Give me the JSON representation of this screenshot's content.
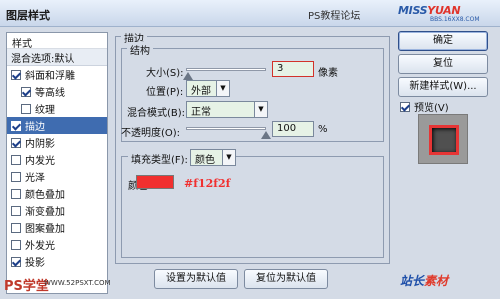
{
  "window": {
    "title": "图层样式"
  },
  "watermark": {
    "text": "PS教程论坛",
    "logo_main": "MISS",
    "logo_accent": "YUAN",
    "logo_url": "BBS.16XX8.COM"
  },
  "sidebar": {
    "header": "样式",
    "blend_options": "混合选项:默认",
    "items": [
      {
        "label": "斜面和浮雕",
        "checked": true
      },
      {
        "label": "等高线",
        "checked": true,
        "indent": true
      },
      {
        "label": "纹理",
        "checked": false,
        "indent": true
      },
      {
        "label": "描边",
        "checked": true,
        "selected": true
      },
      {
        "label": "内阴影",
        "checked": true
      },
      {
        "label": "内发光",
        "checked": false
      },
      {
        "label": "光泽",
        "checked": false
      },
      {
        "label": "颜色叠加",
        "checked": false
      },
      {
        "label": "渐变叠加",
        "checked": false
      },
      {
        "label": "图案叠加",
        "checked": false
      },
      {
        "label": "外发光",
        "checked": false
      },
      {
        "label": "投影",
        "checked": true
      }
    ]
  },
  "stroke": {
    "group_title": "描边",
    "structure_title": "结构",
    "size_label": "大小(S):",
    "size_value": "3",
    "size_unit": "像素",
    "position_label": "位置(P):",
    "position_value": "外部",
    "blend_label": "混合模式(B):",
    "blend_value": "正常",
    "opacity_label": "不透明度(O):",
    "opacity_value": "100",
    "opacity_unit": "%",
    "fill_type_label": "填充类型(F):",
    "fill_type_value": "颜色",
    "color_label": "颜色:",
    "color_hex_text": "#f12f2f",
    "color_hex": "#f12f2f"
  },
  "buttons": {
    "set_default": "设置为默认值",
    "reset_default": "复位为默认值",
    "ok": "确定",
    "reset": "复位",
    "new_style": "新建样式(W)...",
    "preview_label": "预览(V)",
    "preview_checked": true
  },
  "bottom_marks": {
    "ps_logo": "PS学堂",
    "ps_url": "WWW.52PSXT.COM",
    "site_logo": "站长",
    "site_logo_accent": "素材"
  }
}
